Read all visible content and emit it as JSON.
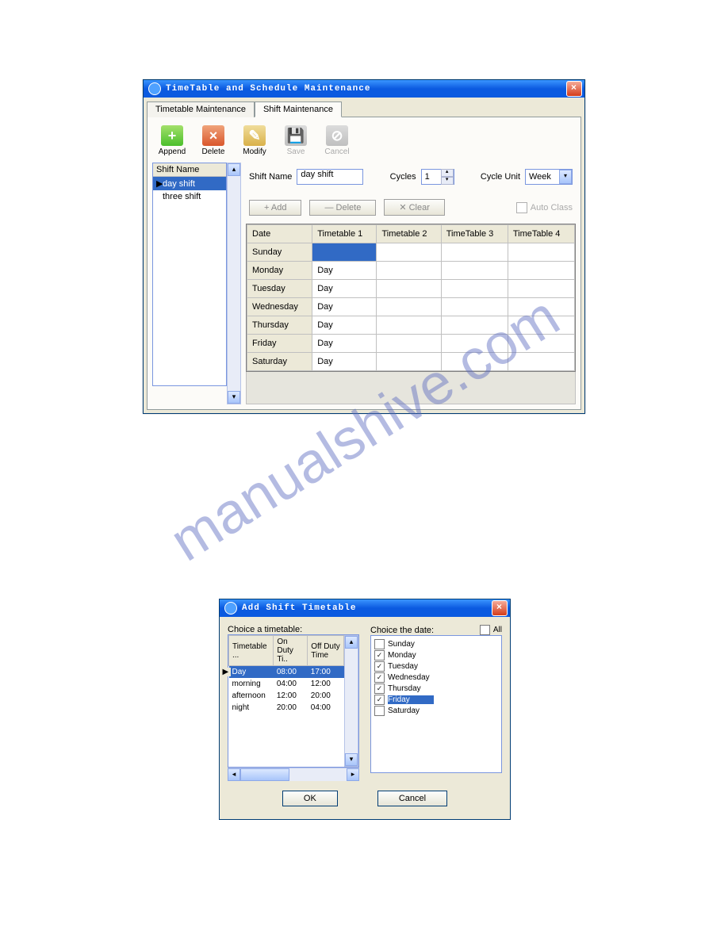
{
  "watermark": "manualshive.com",
  "window1": {
    "title": "TimeTable and Schedule Maintenance",
    "tabs": {
      "inactive": "Timetable Maintenance",
      "active": "Shift Maintenance"
    },
    "toolbar": {
      "append": "Append",
      "delete": "Delete",
      "modify": "Modify",
      "save": "Save",
      "cancel": "Cancel"
    },
    "shiftListHeader": "Shift Name",
    "shiftList": [
      "day shift",
      "three shift"
    ],
    "shiftListSelectedIndex": 0,
    "form": {
      "shiftNameLabel": "Shift Name",
      "shiftNameValue": "day shift",
      "cyclesLabel": "Cycles",
      "cyclesValue": "1",
      "cycleUnitLabel": "Cycle Unit",
      "cycleUnitValue": "Week"
    },
    "buttons": {
      "add": "+ Add",
      "delete": "— Delete",
      "clear": "✕ Clear",
      "autoClass": "Auto Class"
    },
    "grid": {
      "headers": [
        "Date",
        "Timetable 1",
        "Timetable 2",
        "TimeTable 3",
        "TimeTable 4"
      ],
      "rows": [
        {
          "date": "Sunday",
          "t1": "",
          "t2": "",
          "t3": "",
          "t4": "",
          "selected": true
        },
        {
          "date": "Monday",
          "t1": "Day",
          "t2": "",
          "t3": "",
          "t4": ""
        },
        {
          "date": "Tuesday",
          "t1": "Day",
          "t2": "",
          "t3": "",
          "t4": ""
        },
        {
          "date": "Wednesday",
          "t1": "Day",
          "t2": "",
          "t3": "",
          "t4": ""
        },
        {
          "date": "Thursday",
          "t1": "Day",
          "t2": "",
          "t3": "",
          "t4": ""
        },
        {
          "date": "Friday",
          "t1": "Day",
          "t2": "",
          "t3": "",
          "t4": ""
        },
        {
          "date": "Saturday",
          "t1": "Day",
          "t2": "",
          "t3": "",
          "t4": ""
        }
      ]
    }
  },
  "window2": {
    "title": "Add Shift Timetable",
    "leftCaption": "Choice a timetable:",
    "rightCaption": "Choice the date:",
    "allLabel": "All",
    "listHeaders": [
      "Timetable ...",
      "On Duty Ti..",
      "Off Duty Time"
    ],
    "listRows": [
      {
        "name": "Day",
        "on": "08:00",
        "off": "17:00",
        "selected": true
      },
      {
        "name": "morning",
        "on": "04:00",
        "off": "12:00"
      },
      {
        "name": "afternoon",
        "on": "12:00",
        "off": "20:00"
      },
      {
        "name": "night",
        "on": "20:00",
        "off": "04:00"
      }
    ],
    "days": [
      {
        "label": "Sunday",
        "checked": false
      },
      {
        "label": "Monday",
        "checked": true
      },
      {
        "label": "Tuesday",
        "checked": true
      },
      {
        "label": "Wednesday",
        "checked": true
      },
      {
        "label": "Thursday",
        "checked": true
      },
      {
        "label": "Friday",
        "checked": true,
        "selected": true
      },
      {
        "label": "Saturday",
        "checked": false
      }
    ],
    "ok": "OK",
    "cancel": "Cancel"
  }
}
